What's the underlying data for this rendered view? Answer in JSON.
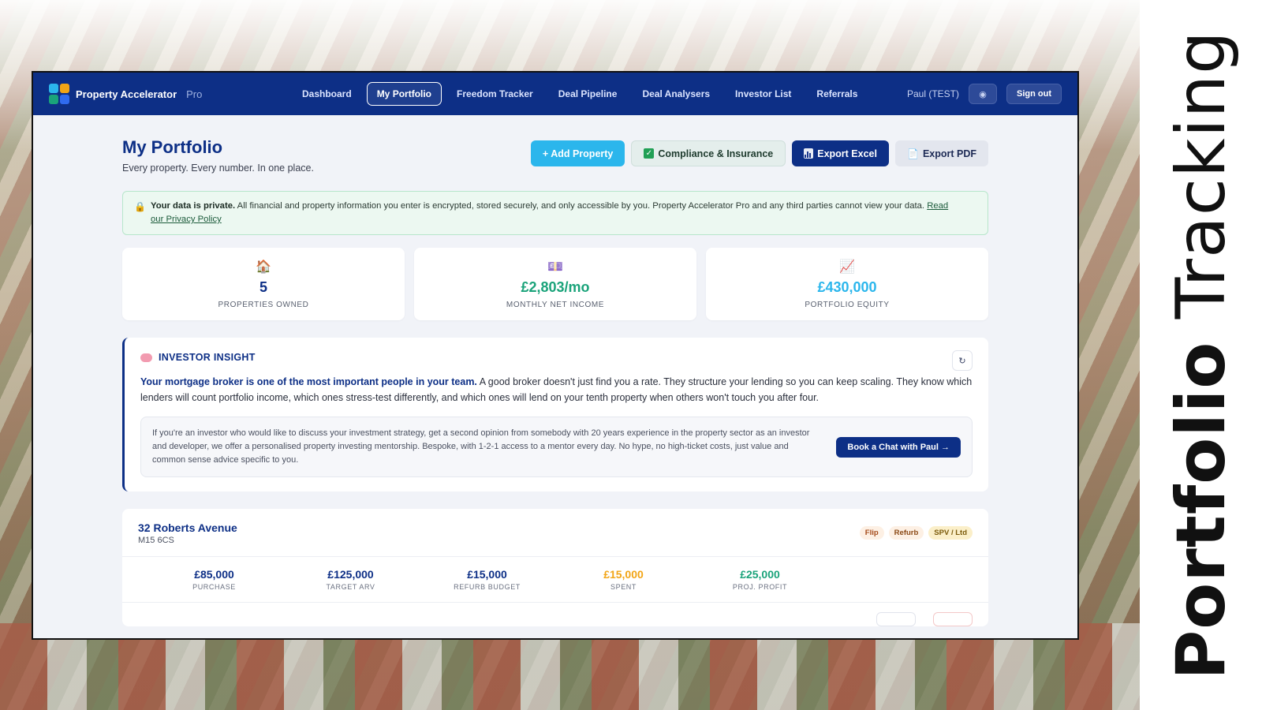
{
  "overlay": {
    "side_title_bold": "Portfolio",
    "side_title_light": "Tracking"
  },
  "app": {
    "brand": "Property Accelerator",
    "brand_suffix": "Pro",
    "nav": [
      {
        "label": "Dashboard"
      },
      {
        "label": "My Portfolio",
        "active": true
      },
      {
        "label": "Freedom Tracker"
      },
      {
        "label": "Deal Pipeline"
      },
      {
        "label": "Deal Analysers"
      },
      {
        "label": "Investor List"
      },
      {
        "label": "Referrals"
      }
    ],
    "user": "Paul (TEST)",
    "sign_out": "Sign out"
  },
  "page": {
    "title": "My Portfolio",
    "subtitle": "Every property. Every number. In one place.",
    "actions": {
      "add_property": "+ Add Property",
      "compliance": "Compliance & Insurance",
      "export_excel": "Export Excel",
      "export_pdf": "Export PDF"
    }
  },
  "privacy": {
    "bold": "Your data is private.",
    "text": " All financial and property information you enter is encrypted, stored securely, and only accessible by you. Property Accelerator Pro and any third parties cannot view your data. ",
    "link": "Read our Privacy Policy"
  },
  "stats": [
    {
      "icon": "house-icon",
      "value": "5",
      "label": "PROPERTIES OWNED",
      "color": "#0d2f86"
    },
    {
      "icon": "money-icon",
      "value": "£2,803/mo",
      "label": "MONTHLY NET INCOME",
      "color": "#1aa37a"
    },
    {
      "icon": "chart-up-icon",
      "value": "£430,000",
      "label": "PORTFOLIO EQUITY",
      "color": "#2bb6ec"
    }
  ],
  "insight": {
    "heading": "INVESTOR INSIGHT",
    "bold": "Your mortgage broker is one of the most important people in your team.",
    "text": " A good broker doesn't just find you a rate. They structure your lending so you can keep scaling. They know which lenders will count portfolio income, which ones stress-test differently, and which ones will lend on your tenth property when others won't touch you after four.",
    "mentor": "If you're an investor who would like to discuss your investment strategy, get a second opinion from somebody with 20 years experience in the property sector as an investor and developer, we offer a personalised property investing mentorship. Bespoke, with 1-2-1 access to a mentor every day. No hype, no high-ticket costs, just value and common sense advice specific to you.",
    "cta": "Book a Chat with Paul →"
  },
  "property": {
    "name": "32 Roberts Avenue",
    "postcode": "M15 6CS",
    "tags": [
      "Flip",
      "Refurb",
      "SPV / Ltd"
    ],
    "metrics": [
      {
        "value": "£85,000",
        "label": "PURCHASE",
        "color": "#0d2f86"
      },
      {
        "value": "£125,000",
        "label": "TARGET ARV",
        "color": "#0d2f86"
      },
      {
        "value": "£15,000",
        "label": "REFURB BUDGET",
        "color": "#0d2f86"
      },
      {
        "value": "£15,000",
        "label": "SPENT",
        "color": "#f2a516"
      },
      {
        "value": "£25,000",
        "label": "PROJ. PROFIT",
        "color": "#1aa37a"
      }
    ]
  }
}
